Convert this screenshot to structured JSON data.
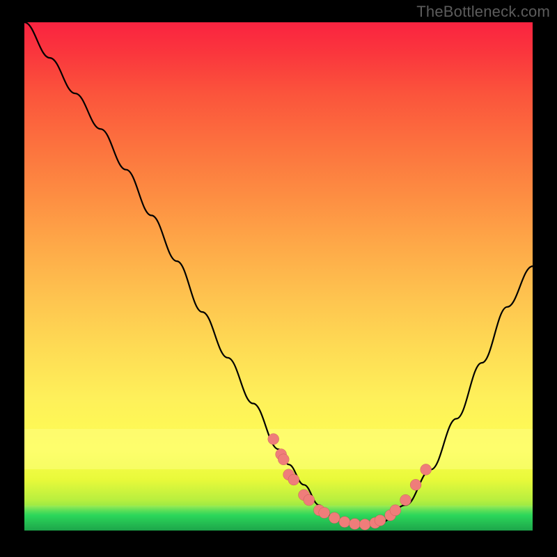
{
  "watermark": "TheBottleneck.com",
  "colors": {
    "background": "#000000",
    "point_fill": "#ef7d7a",
    "curve_stroke": "#000000"
  },
  "chart_data": {
    "type": "line",
    "title": "",
    "xlabel": "",
    "ylabel": "",
    "xlim": [
      0,
      100
    ],
    "ylim": [
      0,
      100
    ],
    "annotations": [
      "TheBottleneck.com"
    ],
    "series": [
      {
        "name": "bottleneck-curve",
        "x": [
          0,
          5,
          10,
          15,
          20,
          25,
          30,
          35,
          40,
          45,
          50,
          52,
          55,
          58,
          60,
          63,
          66,
          70,
          75,
          80,
          85,
          90,
          95,
          100
        ],
        "y": [
          100,
          93,
          86,
          79,
          71,
          62,
          53,
          43,
          34,
          25,
          16,
          13,
          9,
          5,
          3,
          1.5,
          1,
          1.5,
          5,
          12,
          22,
          33,
          44,
          52
        ]
      }
    ],
    "points": {
      "name": "measurements",
      "x": [
        49,
        50.5,
        51,
        52,
        53,
        55,
        56,
        58,
        59,
        61,
        63,
        65,
        67,
        69,
        70,
        72,
        73,
        75,
        77,
        79
      ],
      "y": [
        18,
        15,
        14,
        11,
        10,
        7,
        6,
        4,
        3.5,
        2.5,
        1.7,
        1.3,
        1.2,
        1.5,
        2,
        3,
        4,
        6,
        9,
        12
      ]
    },
    "bands": [
      {
        "name": "highlight-yellow",
        "y_from": 12,
        "y_to": 20
      },
      {
        "name": "highlight-green",
        "y_from": 0,
        "y_to": 5
      }
    ]
  }
}
